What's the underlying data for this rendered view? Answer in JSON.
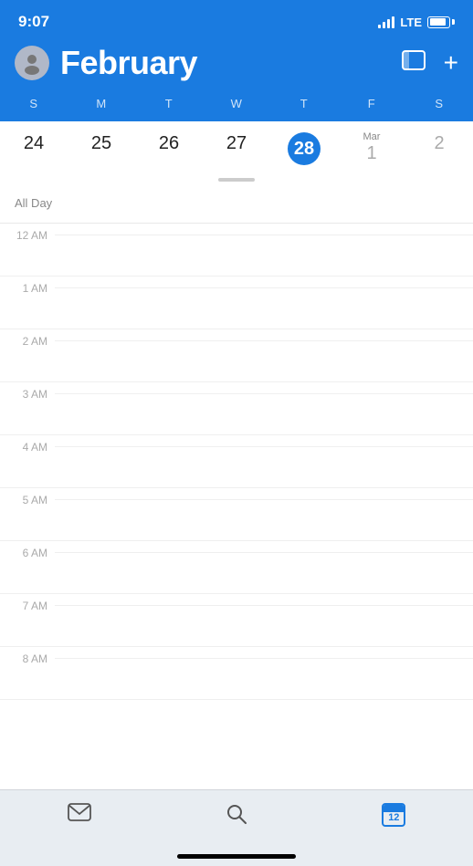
{
  "status": {
    "time": "9:07",
    "lte": "LTE"
  },
  "header": {
    "month": "February",
    "add_label": "+",
    "view_icon": "calendar-view-icon"
  },
  "day_headers": [
    "S",
    "M",
    "T",
    "W",
    "T",
    "F",
    "S"
  ],
  "week": [
    {
      "num": "24",
      "type": "normal"
    },
    {
      "num": "25",
      "type": "normal"
    },
    {
      "num": "26",
      "type": "normal"
    },
    {
      "num": "27",
      "type": "normal"
    },
    {
      "num": "28",
      "type": "today"
    },
    {
      "month_prefix": "Mar",
      "num": "1",
      "type": "next-month"
    },
    {
      "num": "2",
      "type": "next-month"
    }
  ],
  "all_day_label": "All Day",
  "time_slots": [
    "12 AM",
    "1 AM",
    "2 AM",
    "3 AM",
    "4 AM",
    "5 AM",
    "6 AM",
    "7 AM",
    "8 AM"
  ],
  "tab_bar": {
    "mail_label": "mail",
    "search_label": "search",
    "calendar_label": "12"
  }
}
